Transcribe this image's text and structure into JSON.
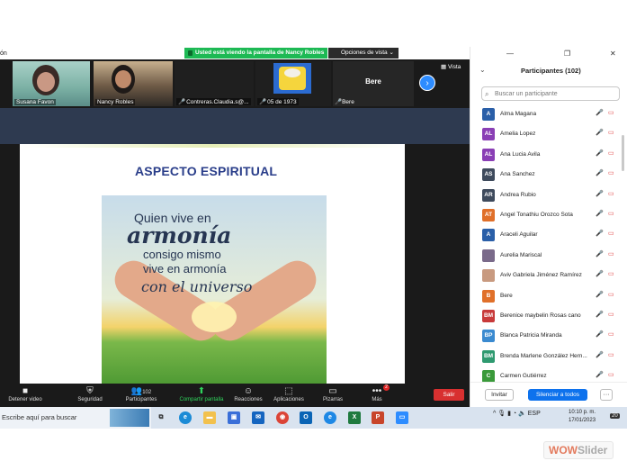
{
  "window": {
    "edge_text": "ón",
    "share_banner": "Usted está viendo la pantalla de Nancy Robles",
    "view_options": "Opciones de vista ⌄",
    "vista_label": "Vista"
  },
  "video_strip": [
    {
      "name": "Susana Favon"
    },
    {
      "name": "Nancy Robles"
    },
    {
      "name": "Contreras.Claudia.s@..."
    },
    {
      "name": "05 de 1973"
    },
    {
      "name": "Bere",
      "big_label": "Bere"
    }
  ],
  "slide": {
    "title": "ASPECTO ESPIRITUAL",
    "line1": "Quien vive en",
    "line2": "armonía",
    "line3": "consigo mismo",
    "line4": "vive en armonía",
    "line5": "con el universo"
  },
  "toolbar": {
    "video": "Detener video",
    "security": "Seguridad",
    "participants": "Participantes",
    "participants_count": "102",
    "share": "Compartir pantalla",
    "reactions": "Reacciones",
    "apps": "Aplicaciones",
    "whiteboards": "Pizarras",
    "more": "Más",
    "more_badge": "2",
    "leave": "Salir"
  },
  "panel": {
    "title": "Participantes (102)",
    "search_placeholder": "Buscar un participante",
    "participants": [
      {
        "initials": "A",
        "name": "Alma Magana",
        "color": "#2a5fa8"
      },
      {
        "initials": "AL",
        "name": "Amelia Lopez",
        "color": "#8a3fb5"
      },
      {
        "initials": "AL",
        "name": "Ana Lucia Avila",
        "color": "#8a3fb5"
      },
      {
        "initials": "AS",
        "name": "Ana Sanchez",
        "color": "#3e4a5c"
      },
      {
        "initials": "AR",
        "name": "Andrea Rubio",
        "color": "#3e4a5c"
      },
      {
        "initials": "AT",
        "name": "Angel Tonathiu Orozco Sota",
        "color": "#e0702a"
      },
      {
        "initials": "A",
        "name": "Araceli Aguilar",
        "color": "#2a5fa8"
      },
      {
        "initials": "",
        "name": "Aurelia Mariscal",
        "color": "#7a6a8a"
      },
      {
        "initials": "",
        "name": "Aviv Gabriela Jiménez Ramírez",
        "color": "#c89a80"
      },
      {
        "initials": "B",
        "name": "Bere",
        "color": "#e0702a"
      },
      {
        "initials": "BM",
        "name": "Berenice maybelin Rosas cano",
        "color": "#c83a3a"
      },
      {
        "initials": "BP",
        "name": "Blanca Patricia Miranda",
        "color": "#3a8ad0"
      },
      {
        "initials": "BM",
        "name": "Brenda Marlene González Hern...",
        "color": "#2f9a70"
      },
      {
        "initials": "C",
        "name": "Carmen Gutiérrez",
        "color": "#3a9a3a"
      }
    ],
    "invite": "Invitar",
    "mute_all": "Silenciar a todos",
    "more": "···"
  },
  "taskbar": {
    "search": "Escribe aquí para buscar",
    "lang": "ESP",
    "time": "10:10 p. m.",
    "date": "17/01/2023",
    "notif": "20"
  },
  "watermark": {
    "part1": "WOW",
    "part2": "Slider"
  }
}
